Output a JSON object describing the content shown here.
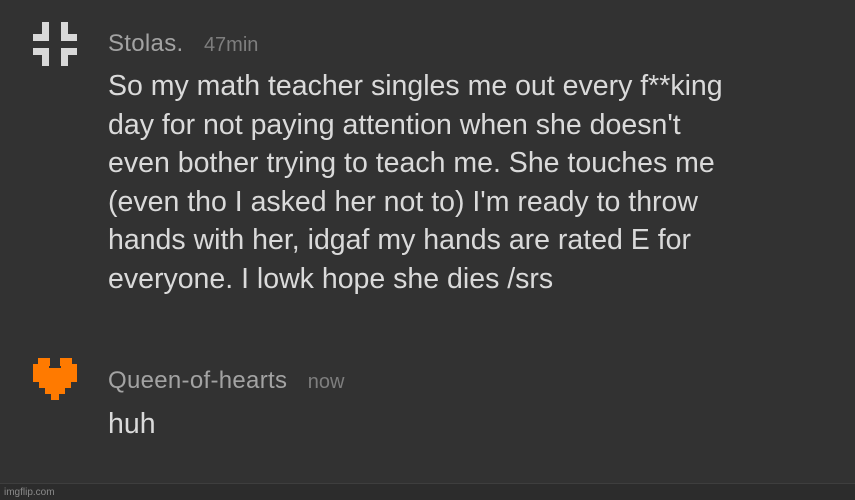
{
  "comments": [
    {
      "username": "Stolas.",
      "time": "47min",
      "text": "So my math teacher singles me out every f**king\nday for not paying attention when she doesn't\neven bother trying to teach me. She touches me\n(even tho I asked her not to) I'm ready to throw\nhands with her, idgaf my hands are rated E for\neveryone. I lowk hope she dies /srs",
      "avatar_icon": "grid-cross-icon",
      "avatar_color": "#d8d8d8"
    },
    {
      "username": "Queen-of-hearts",
      "time": "now",
      "text": "huh",
      "avatar_icon": "pixel-heart-icon",
      "avatar_color": "#ff7a00"
    }
  ],
  "watermark": "imgflip.com"
}
